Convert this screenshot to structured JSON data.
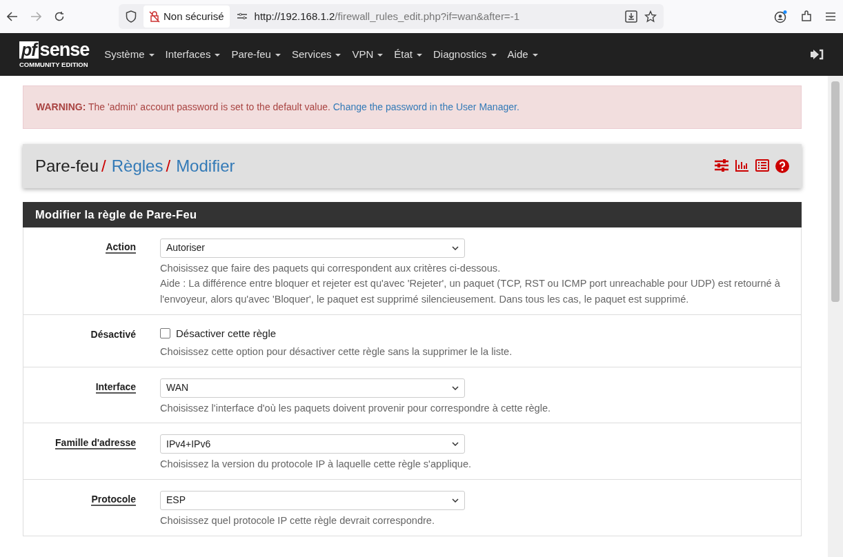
{
  "browser": {
    "security": "Non sécurisé",
    "url_host": "http://192.168.1.2",
    "url_path": "/firewall_rules_edit.php?if=wan&after=-1"
  },
  "navbar": {
    "logo_main": "sense",
    "logo_prefix": "pf",
    "logo_sub": "COMMUNITY EDITION",
    "menus": [
      "Système",
      "Interfaces",
      "Pare-feu",
      "Services",
      "VPN",
      "État",
      "Diagnostics",
      "Aide"
    ]
  },
  "alert": {
    "label": "WARNING:",
    "message": "The 'admin' account password is set to the default value.",
    "link": "Change the password in the User Manager."
  },
  "breadcrumb_separator": "/",
  "breadcrumb": [
    {
      "text": "Pare-feu",
      "link": false
    },
    {
      "text": "Règles",
      "link": true
    },
    {
      "text": "Modifier",
      "link": true
    }
  ],
  "panel": {
    "title": "Modifier la règle de Pare-Feu",
    "fields": [
      {
        "kind": "select",
        "label": "Action",
        "underlined": true,
        "value": "Autoriser",
        "help": [
          "Choisissez que faire des paquets qui correspondent aux critères ci-dessous.",
          "Aide : La différence entre bloquer et rejeter est qu'avec 'Rejeter', un paquet (TCP, RST ou ICMP port unreachable pour UDP) est retourné à l'envoyeur, alors qu'avec 'Bloquer', le paquet est supprimé silencieusement. Dans tous les cas, le paquet est supprimé."
        ]
      },
      {
        "kind": "checkbox",
        "label": "Désactivé",
        "underlined": false,
        "checked": false,
        "value": "Désactiver cette règle",
        "help": [
          "Choisissez cette option pour désactiver cette règle sans la supprimer le la liste."
        ]
      },
      {
        "kind": "select",
        "label": "Interface",
        "underlined": true,
        "value": "WAN",
        "help": [
          "Choisissez l'interface d'où les paquets doivent provenir pour correspondre à cette règle."
        ]
      },
      {
        "kind": "select",
        "label": "Famille d'adresse",
        "underlined": true,
        "value": "IPv4+IPv6",
        "help": [
          "Choisissez la version du protocole IP à laquelle cette règle s'applique."
        ]
      },
      {
        "kind": "select",
        "label": "Protocole",
        "underlined": true,
        "value": "ESP",
        "help": [
          "Choisissez quel protocole IP cette règle devrait correspondre."
        ]
      }
    ]
  }
}
